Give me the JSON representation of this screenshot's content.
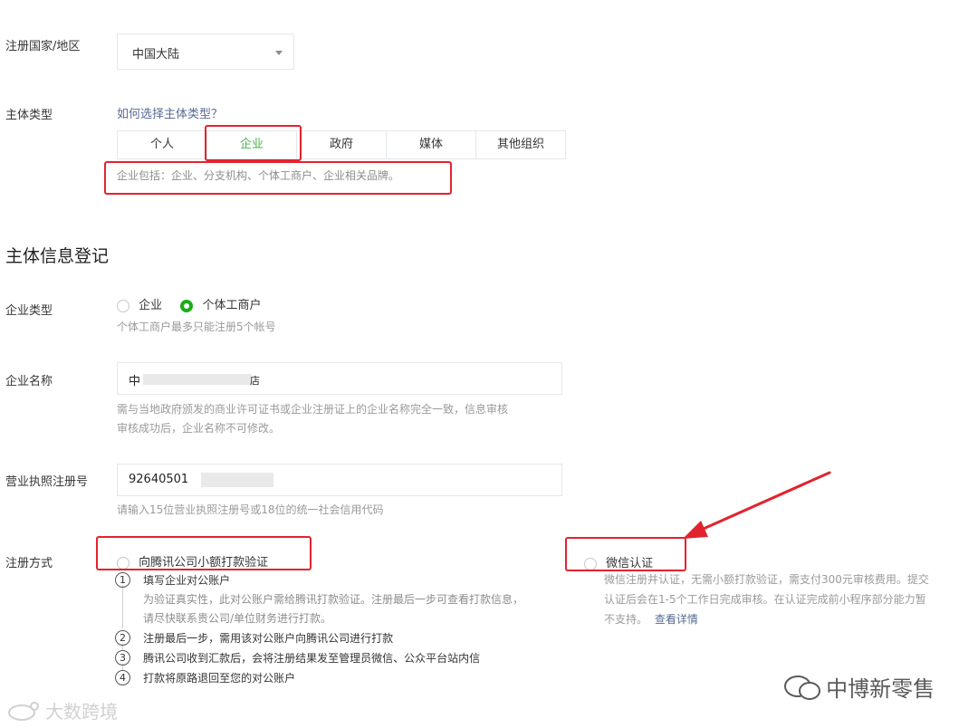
{
  "region": {
    "label": "注册国家/地区",
    "value": "中国大陆"
  },
  "entity_type": {
    "label": "主体类型",
    "help_link": "如何选择主体类型？",
    "tabs": [
      "个人",
      "企业",
      "政府",
      "媒体",
      "其他组织"
    ],
    "selected_tab": "企业",
    "description": "企业包括：企业、分支机构、个体工商户、企业相关品牌。"
  },
  "section_title": "主体信息登记",
  "company_kind": {
    "label": "企业类型",
    "options": [
      "企业",
      "个体工商户"
    ],
    "selected": "个体工商户",
    "hint": "个体工商户最多只能注册5个帐号"
  },
  "company_name": {
    "label": "企业名称",
    "value_start": "中",
    "value_end": "店",
    "hint_line1": "需与当地政府颁发的商业许可证书或企业注册证上的企业名称完全一致，信息审核",
    "hint_line2": "审核成功后，企业名称不可修改。"
  },
  "license": {
    "label": "营业执照注册号",
    "value": "92640501",
    "hint": "请输入15位营业执照注册号或18位的统一社会信用代码"
  },
  "register_method": {
    "label": "注册方式",
    "option_bank": "向腾讯公司小额打款验证",
    "option_wechat": "微信认证",
    "steps": [
      {
        "num": "1",
        "title": "填写企业对公账户",
        "desc1": "为验证真实性，此对公账户需给腾讯打款验证。注册最后一步可查看打款信息，",
        "desc2": "请尽快联系贵公司/单位财务进行打款。"
      },
      {
        "num": "2",
        "title": "注册最后一步，需用该对公账户向腾讯公司进行打款"
      },
      {
        "num": "3",
        "title": "腾讯公司收到汇款后，会将注册结果发至管理员微信、公众平台站内信"
      },
      {
        "num": "4",
        "title": "打款将原路退回至您的对公账户"
      }
    ],
    "wechat_desc1": "微信注册并认证，无需小额打款验证，需支付300元审核费用。提交",
    "wechat_desc2": "认证后会在1-5个工作日完成审核。在认证完成前小程序部分能力暂",
    "wechat_desc3": "不支持。",
    "wechat_link": "查看详情"
  },
  "watermarks": {
    "right": "中博新零售",
    "left": "大数跨境"
  },
  "colors": {
    "accent": "#44b549",
    "annotation": "#e2232f",
    "link": "#576b95"
  }
}
